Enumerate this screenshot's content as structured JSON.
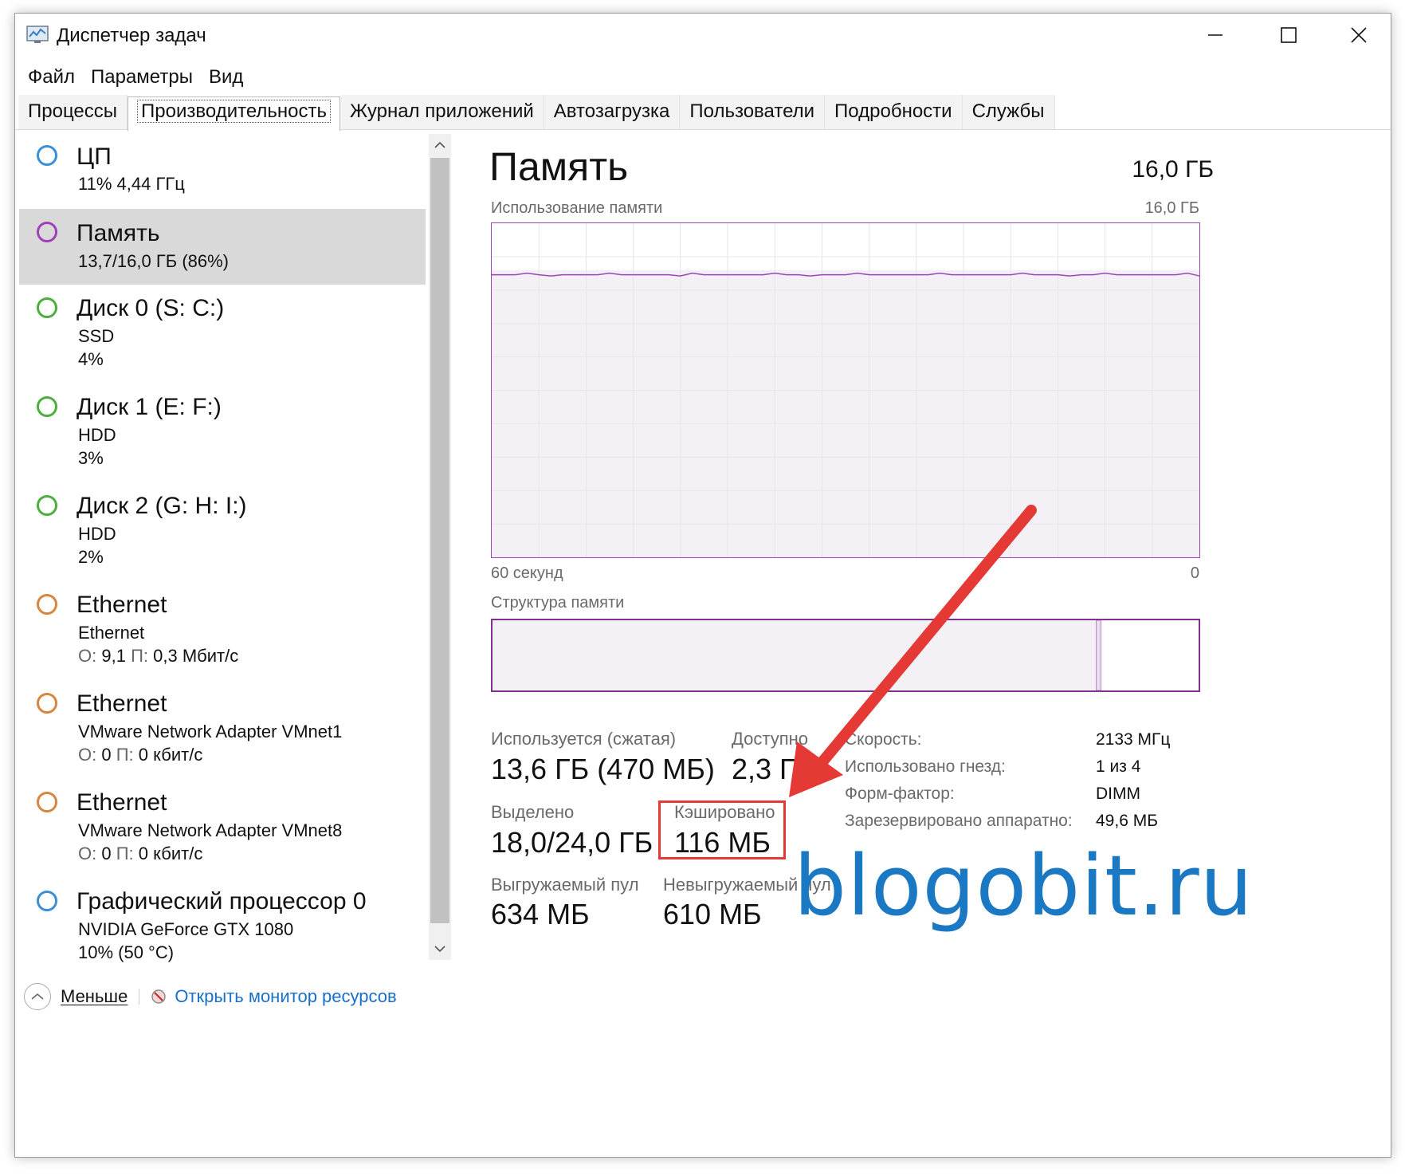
{
  "window": {
    "title": "Диспетчер задач"
  },
  "menu": [
    "Файл",
    "Параметры",
    "Вид"
  ],
  "tabs": [
    "Процессы",
    "Производительность",
    "Журнал приложений",
    "Автозагрузка",
    "Пользователи",
    "Подробности",
    "Службы"
  ],
  "active_tab": "Производительность",
  "sidebar": {
    "items": [
      {
        "title": "ЦП",
        "lines": [
          "11%  4,44 ГГц"
        ],
        "color": "#3a8fd6"
      },
      {
        "title": "Память",
        "lines": [
          "13,7/16,0 ГБ (86%)"
        ],
        "color": "#a040b8",
        "selected": true
      },
      {
        "title": "Диск 0 (S: C:)",
        "lines": [
          "SSD",
          "4%"
        ],
        "color": "#4caf3b"
      },
      {
        "title": "Диск 1 (E: F:)",
        "lines": [
          "HDD",
          "3%"
        ],
        "color": "#4caf3b"
      },
      {
        "title": "Диск 2 (G: H: I:)",
        "lines": [
          "HDD",
          "2%"
        ],
        "color": "#4caf3b"
      },
      {
        "title": "Ethernet",
        "lines": [
          "Ethernet"
        ],
        "traffic": {
          "o_label": "О:",
          "o_val": "9,1",
          "p_label": "П:",
          "p_val": "0,3 Мбит/с"
        },
        "color": "#d7863f"
      },
      {
        "title": "Ethernet",
        "lines": [
          "VMware Network Adapter VMnet1"
        ],
        "traffic": {
          "o_label": "О:",
          "o_val": "0",
          "p_label": "П:",
          "p_val": "0 кбит/с"
        },
        "color": "#d7863f"
      },
      {
        "title": "Ethernet",
        "lines": [
          "VMware Network Adapter VMnet8"
        ],
        "traffic": {
          "o_label": "О:",
          "o_val": "0",
          "p_label": "П:",
          "p_val": "0 кбит/с"
        },
        "color": "#d7863f"
      },
      {
        "title": "Графический процессор 0",
        "lines": [
          "NVIDIA GeForce GTX 1080",
          "10% (50 °C)"
        ],
        "color": "#3a8fd6"
      }
    ]
  },
  "panel": {
    "title": "Память",
    "total": "16,0 ГБ",
    "usage_label": "Использование памяти",
    "usage_max": "16,0 ГБ",
    "time_left": "60 секунд",
    "time_right": "0",
    "structure_label": "Структура памяти",
    "usage_fraction": 0.86,
    "structure_used_fraction": 0.855,
    "stats": {
      "in_use_label": "Используется (сжатая)",
      "in_use_value": "13,6 ГБ (470 МБ)",
      "available_label": "Доступно",
      "available_value": "2,3 ГБ",
      "committed_label": "Выделено",
      "committed_value": "18,0/24,0 ГБ",
      "cached_label": "Кэшировано",
      "cached_value": "116 МБ",
      "paged_label": "Выгружаемый пул",
      "paged_value": "634 МБ",
      "nonpaged_label": "Невыгружаемый пул",
      "nonpaged_value": "610 МБ"
    },
    "specs": [
      {
        "key": "Скорость:",
        "value": "2133 МГц"
      },
      {
        "key": "Использовано гнезд:",
        "value": "1 из 4"
      },
      {
        "key": "Форм-фактор:",
        "value": "DIMM"
      },
      {
        "key": "Зарезервировано аппаратно:",
        "value": "49,6 МБ"
      }
    ]
  },
  "footer": {
    "less_label": "Меньше",
    "monitor_label": "Открыть монитор ресурсов"
  },
  "watermark": "blogobit.ru",
  "colors": {
    "memory_accent": "#9d46b2",
    "arrow": "#e53935",
    "link": "#1a6fc9",
    "watermark": "#1b78c2"
  }
}
